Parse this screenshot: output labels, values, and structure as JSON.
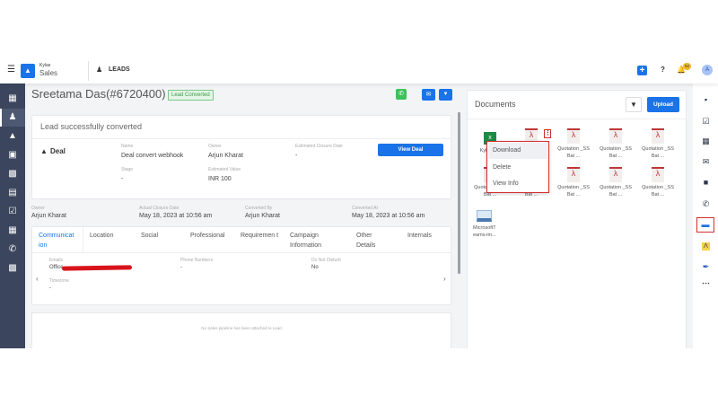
{
  "header": {
    "brand_top": "Kylas",
    "brand_bottom": "Sales",
    "module": "LEADS",
    "notif_count": "52",
    "avatar": "A"
  },
  "lead": {
    "title": "Sreetama Das(#6720400)",
    "badge": "Lead Converted"
  },
  "conversion": {
    "heading": "Lead successfully converted",
    "deal_label": "Deal",
    "view_deal": "View Deal",
    "fields": [
      {
        "label": "Name",
        "value": "Deal convert webhook"
      },
      {
        "label": "Owner",
        "value": "Arjun Kharat"
      },
      {
        "label": "Estimated Closure Date",
        "value": "-"
      },
      {
        "label": "Stage",
        "value": "-"
      },
      {
        "label": "Estimated Value",
        "value": "INR 100"
      }
    ]
  },
  "summary": [
    {
      "label": "Owner",
      "value": "Arjun Kharat"
    },
    {
      "label": "Actual Closure Date",
      "value": "May 18, 2023 at 10:56 am"
    },
    {
      "label": "Converted By",
      "value": "Arjun Kharat"
    },
    {
      "label": "Converted At",
      "value": "May 18, 2023 at 10:56 am"
    }
  ],
  "tabs": [
    {
      "label": "Communicat ion"
    },
    {
      "label": "Location"
    },
    {
      "label": "Social"
    },
    {
      "label": "Professional"
    },
    {
      "label": "Requiremen t"
    },
    {
      "label": "Campaign Information"
    },
    {
      "label": "Other Details"
    },
    {
      "label": "Internals"
    }
  ],
  "communication": {
    "emails_label": "Emails",
    "emails_value": "Office",
    "phone_label": "Phone Numbers",
    "phone_value": "-",
    "dnd_label": "Do Not Disturb",
    "dnd_value": "No",
    "tz_label": "Timezone",
    "tz_value": "-"
  },
  "pipeline": {
    "empty": "No Sales pipeline has been attached to Lead"
  },
  "documents": {
    "title": "Documents",
    "upload": "Upload",
    "files": [
      {
        "name": "Kylas d...",
        "type": "excel"
      },
      {
        "name": "",
        "type": "pdf"
      },
      {
        "name": "Quotation _SS Bat ...",
        "type": "pdf"
      },
      {
        "name": "Quotation _SS Bat ...",
        "type": "pdf"
      },
      {
        "name": "Quotation _SS Bat ...",
        "type": "pdf"
      },
      {
        "name": "Quotation _SS Bat ...",
        "type": "pdf"
      },
      {
        "name": "Quotation _SS Bat ...",
        "type": "pdf"
      },
      {
        "name": "Quotation _SS Bat ...",
        "type": "pdf"
      },
      {
        "name": "Quotation _SS Bat ...",
        "type": "pdf"
      },
      {
        "name": "Quotation _SS Bat ...",
        "type": "pdf"
      },
      {
        "name": "MicrosoftT eams-im...",
        "type": "image"
      }
    ],
    "menu": [
      "Download",
      "Delete",
      "View Info"
    ]
  },
  "colors": {
    "primary": "#1a73e8",
    "sidebar": "#3b465e",
    "highlight": "#d32f2f",
    "badge": "#4caf50"
  }
}
